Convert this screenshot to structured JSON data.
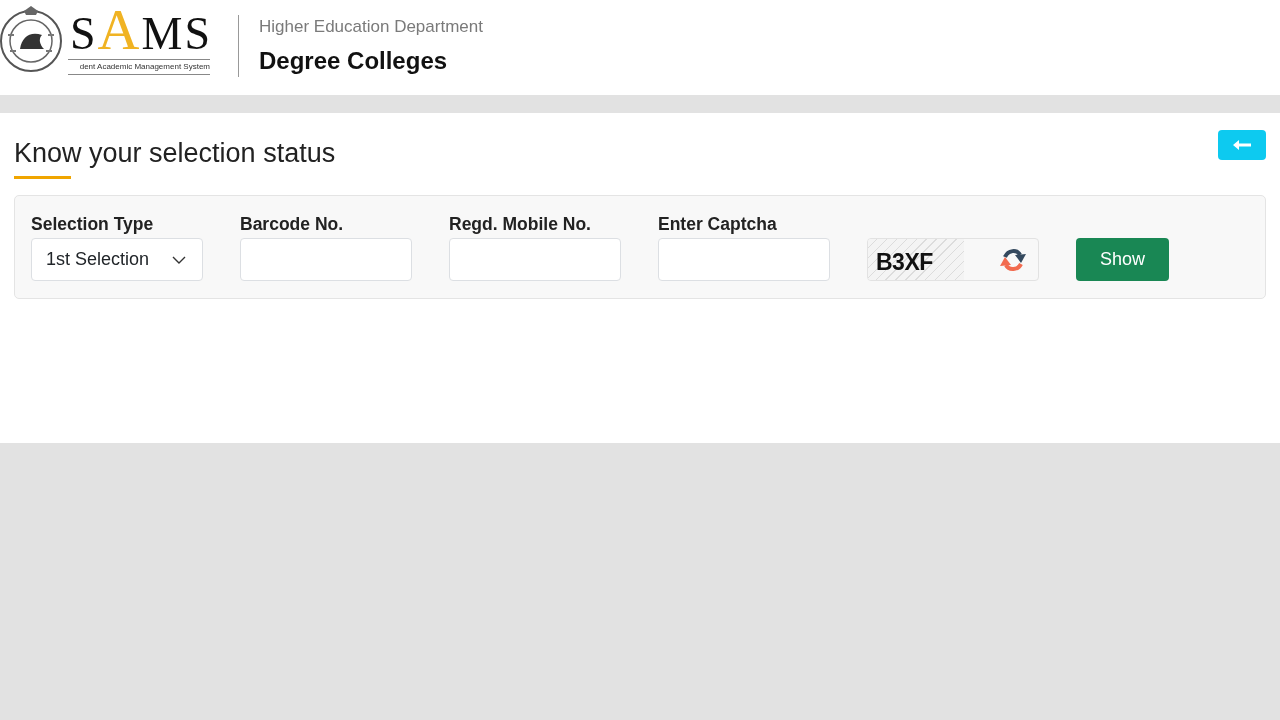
{
  "header": {
    "logo": {
      "wordmark": [
        {
          "text": "S",
          "accent": false
        },
        {
          "text": "A",
          "accent": true
        },
        {
          "text": "MS",
          "accent": false
        }
      ],
      "tagline": "dent Academic Management System"
    },
    "department": "Higher Education Department",
    "portal": "Degree Colleges"
  },
  "page": {
    "title": "Know your selection status"
  },
  "form": {
    "fields": [
      {
        "kind": "select",
        "label": "Selection Type",
        "value": "1st Selection"
      },
      {
        "kind": "text",
        "label": "Barcode No."
      },
      {
        "kind": "text",
        "label": "Regd. Mobile No."
      },
      {
        "kind": "text",
        "label": "Enter Captcha"
      }
    ],
    "captcha": {
      "code": "B3XF"
    },
    "submit_button": "Show"
  }
}
